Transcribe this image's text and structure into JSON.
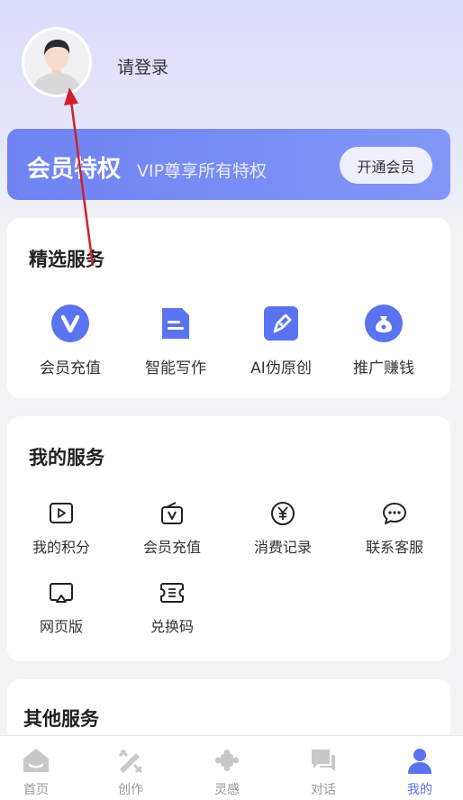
{
  "profile": {
    "login_text": "请登录"
  },
  "vip": {
    "title": "会员特权",
    "subtitle": "VIP尊享所有特权",
    "button": "开通会员"
  },
  "featured": {
    "title": "精选服务",
    "items": [
      {
        "label": "会员充值",
        "icon": "vip-v-icon"
      },
      {
        "label": "智能写作",
        "icon": "document-icon"
      },
      {
        "label": "AI伪原创",
        "icon": "pen-icon"
      },
      {
        "label": "推广赚钱",
        "icon": "money-bag-icon"
      }
    ]
  },
  "my_services": {
    "title": "我的服务",
    "items": [
      {
        "label": "我的积分",
        "icon": "play-box-icon"
      },
      {
        "label": "会员充值",
        "icon": "vip-box-icon"
      },
      {
        "label": "消费记录",
        "icon": "yen-icon"
      },
      {
        "label": "联系客服",
        "icon": "chat-icon"
      },
      {
        "label": "网页版",
        "icon": "screen-icon"
      },
      {
        "label": "兑换码",
        "icon": "coupon-icon"
      }
    ]
  },
  "other": {
    "title": "其他服务"
  },
  "tabbar": {
    "items": [
      {
        "label": "首页",
        "icon": "home-icon"
      },
      {
        "label": "创作",
        "icon": "create-icon"
      },
      {
        "label": "灵感",
        "icon": "inspiration-icon"
      },
      {
        "label": "对话",
        "icon": "chat-bubble-icon"
      },
      {
        "label": "我的",
        "icon": "user-icon"
      }
    ],
    "active": "我的"
  },
  "colors": {
    "accent": "#5a73f0",
    "vip_gradient_start": "#6f83f2",
    "vip_gradient_end": "#8397f7",
    "annotation_arrow": "#d11f2a"
  }
}
